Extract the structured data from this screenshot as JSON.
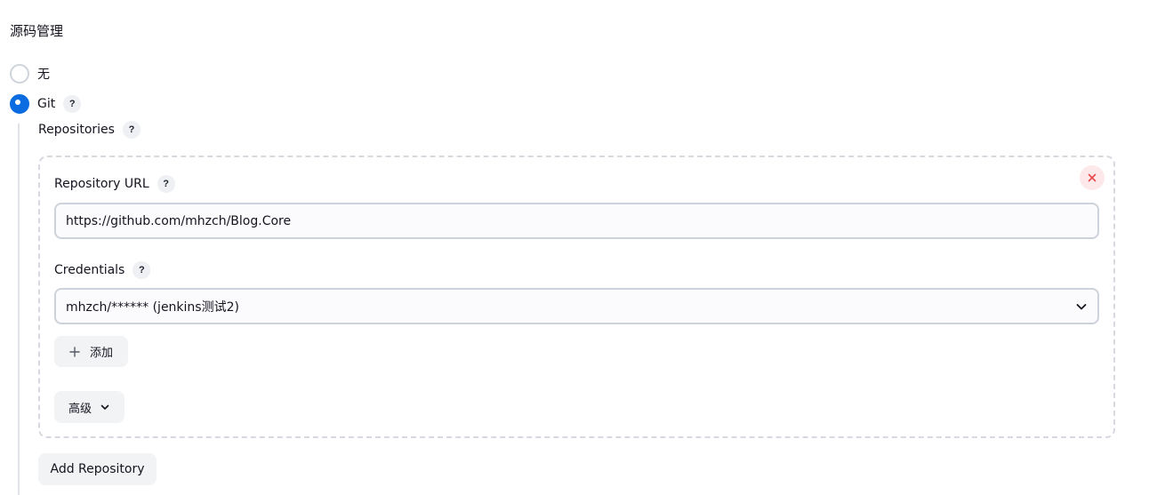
{
  "section": {
    "title": "源码管理"
  },
  "scm_options": {
    "none_label": "无",
    "git_label": "Git"
  },
  "help_glyph": "?",
  "repositories": {
    "label": "Repositories",
    "items": [
      {
        "url_label": "Repository URL",
        "url_value": "https://github.com/mhzch/Blog.Core",
        "credentials_label": "Credentials",
        "credentials_selected": "mhzch/****** (jenkins测试2)",
        "add_label": "添加",
        "advanced_label": "高级"
      }
    ],
    "add_repository_label": "Add Repository"
  },
  "selected_scm": "Git",
  "colors": {
    "accent": "#0b6be0",
    "danger": "#e5484d",
    "danger_bg": "#fde8ea",
    "button_bg": "#f2f3f5",
    "border": "#cdd3db"
  },
  "icons": {
    "help": "question-mark-icon",
    "close": "close-icon",
    "select": "chevron-down-icon",
    "add": "plus-icon",
    "advanced": "chevron-down-icon"
  }
}
